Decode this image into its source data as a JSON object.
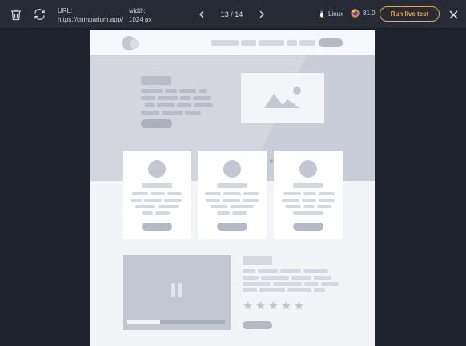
{
  "toolbar": {
    "url_label": "URL:",
    "url_value": "https://comparium.app/",
    "width_label": "width:",
    "width_value": "1024 px",
    "page_counter": "13 / 14",
    "os_name": "Linux",
    "browser_version": "81.0",
    "run_label": "Run live test"
  },
  "icons": {
    "trash": "trash-icon",
    "refresh": "refresh-icon",
    "prev": "chevron-left-icon",
    "next": "chevron-right-icon",
    "os": "linux-icon",
    "browser": "firefox-icon",
    "close": "close-icon"
  },
  "colors": {
    "accent": "#f2a93b",
    "background": "#1f232d",
    "toolbar": "#272b36"
  },
  "preview": {
    "rating_stars": 5,
    "video_progress": 0.34
  }
}
